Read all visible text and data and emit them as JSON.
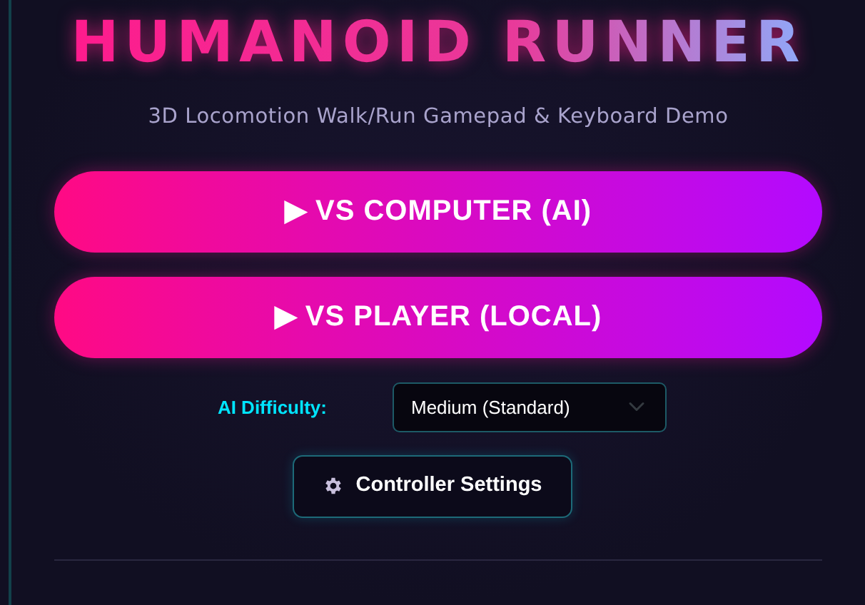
{
  "title": "HUMANOID RUNNER",
  "subtitle": "3D Locomotion Walk/Run Gamepad & Keyboard Demo",
  "mode_buttons": [
    {
      "label": "▶ VS COMPUTER (AI)"
    },
    {
      "label": "▶ VS PLAYER (LOCAL)"
    }
  ],
  "difficulty": {
    "label": "AI Difficulty:",
    "value": "Medium (Standard)"
  },
  "settings_button": {
    "label": "Controller Settings"
  }
}
